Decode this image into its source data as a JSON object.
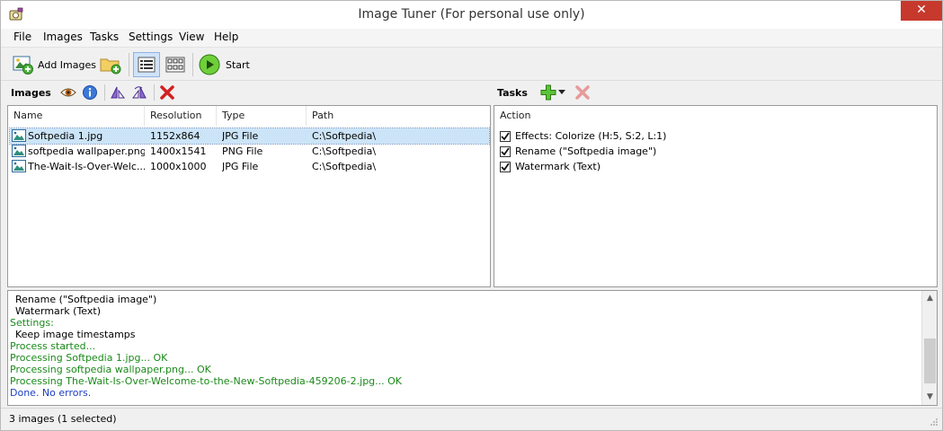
{
  "window": {
    "title": "Image Tuner (For personal use only)",
    "close_glyph": "✕"
  },
  "menu": [
    "File",
    "Images",
    "Tasks",
    "Settings",
    "View",
    "Help"
  ],
  "toolbar": {
    "add_images_label": "Add Images",
    "start_label": "Start"
  },
  "images_panel": {
    "title": "Images",
    "columns": [
      "Name",
      "Resolution",
      "Type",
      "Path"
    ],
    "rows": [
      {
        "name": "Softpedia 1.jpg",
        "resolution": "1152x864",
        "type": "JPG File",
        "path": "C:\\Softpedia\\",
        "selected": true
      },
      {
        "name": "softpedia wallpaper.png",
        "resolution": "1400x1541",
        "type": "PNG File",
        "path": "C:\\Softpedia\\",
        "selected": false
      },
      {
        "name": "The-Wait-Is-Over-Welc...",
        "resolution": "1000x1000",
        "type": "JPG File",
        "path": "C:\\Softpedia\\",
        "selected": false
      }
    ]
  },
  "tasks_panel": {
    "title": "Tasks",
    "column": "Action",
    "items": [
      {
        "label": "Effects: Colorize (H:5, S:2, L:1)",
        "checked": true
      },
      {
        "label": "Rename (\"Softpedia image\")",
        "checked": true
      },
      {
        "label": "Watermark (Text)",
        "checked": true
      }
    ]
  },
  "log": {
    "lines": [
      {
        "text": "Rename (\"Softpedia image\")",
        "style": "black"
      },
      {
        "text": "Watermark (Text)",
        "style": "black"
      },
      {
        "text": "Settings:",
        "style": "green"
      },
      {
        "text": "Keep image timestamps",
        "style": "black"
      },
      {
        "text": "Process started...",
        "style": "green"
      },
      {
        "text": "Processing Softpedia 1.jpg... OK",
        "style": "green"
      },
      {
        "text": "Processing softpedia wallpaper.png... OK",
        "style": "green"
      },
      {
        "text": "Processing The-Wait-Is-Over-Welcome-to-the-New-Softpedia-459206-2.jpg... OK",
        "style": "green"
      },
      {
        "text": "Done. No errors.",
        "style": "blue"
      }
    ]
  },
  "status": {
    "text": "3 images (1 selected)"
  },
  "colors": {
    "selection": "#cce4f7",
    "log_green": "#1a8a1a",
    "log_blue": "#1d3fc2",
    "close_red": "#c7392d"
  },
  "icons": {
    "app": "camera-icon",
    "add_images": "add-image-icon",
    "add_folder": "add-folder-icon",
    "details_view": "details-view-icon",
    "thumbnails_view": "thumbnails-view-icon",
    "start": "play-icon",
    "preview": "eye-icon",
    "info": "info-icon",
    "rotate_left": "rotate-left-icon",
    "rotate_right": "rotate-right-icon",
    "remove": "red-x-icon",
    "add_task": "green-plus-icon",
    "remove_task": "gray-x-icon"
  }
}
